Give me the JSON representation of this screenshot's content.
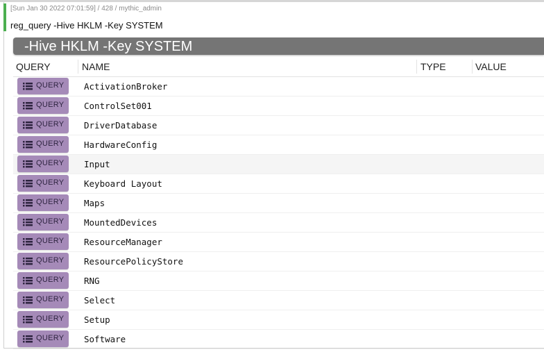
{
  "task": {
    "meta": "[Sun Jan 30 2022 07:01:59] / 428 / mythic_admin",
    "command": "reg_query -Hive HKLM -Key SYSTEM"
  },
  "table": {
    "title": "-Hive HKLM -Key SYSTEM",
    "columns": {
      "query": "QUERY",
      "name": "NAME",
      "type": "TYPE",
      "value": "VALUE"
    },
    "button_label": "QUERY",
    "button_icon": "list-icon",
    "button_color": "#a58ab8",
    "header_bar_color": "#757575",
    "rows": [
      {
        "name": "ActivationBroker"
      },
      {
        "name": "ControlSet001"
      },
      {
        "name": "DriverDatabase"
      },
      {
        "name": "HardwareConfig"
      },
      {
        "name": "Input",
        "highlighted": true
      },
      {
        "name": "Keyboard Layout"
      },
      {
        "name": "Maps"
      },
      {
        "name": "MountedDevices"
      },
      {
        "name": "ResourceManager"
      },
      {
        "name": "ResourcePolicyStore"
      },
      {
        "name": "RNG"
      },
      {
        "name": "Select"
      },
      {
        "name": "Setup"
      },
      {
        "name": "Software"
      }
    ]
  }
}
